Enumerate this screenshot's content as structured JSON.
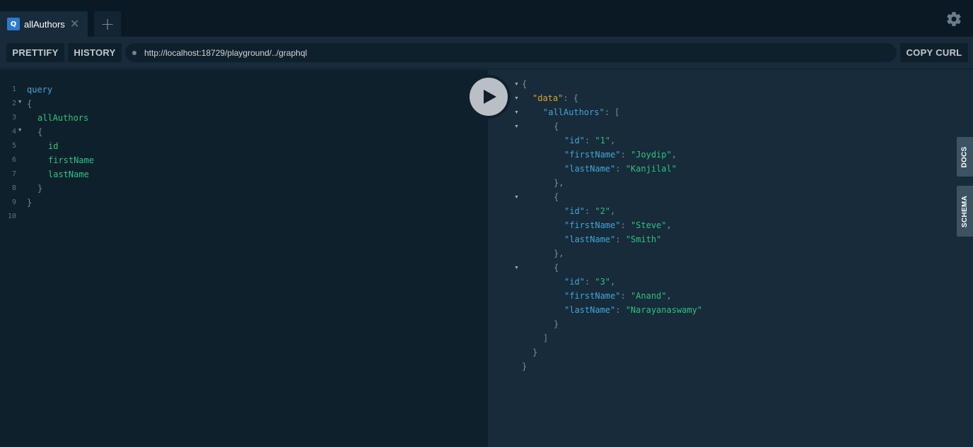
{
  "tabs": [
    {
      "icon": "Q",
      "label": "allAuthors",
      "close": "✕"
    }
  ],
  "add_tab": "+",
  "toolbar": {
    "prettify": "PRETTIFY",
    "history": "HISTORY",
    "url": "http://localhost:18729/playground/../graphql",
    "copy_curl": "COPY CURL"
  },
  "editor": {
    "line_numbers": [
      "1",
      "2",
      "3",
      "4",
      "5",
      "6",
      "7",
      "8",
      "9",
      "10"
    ],
    "lines": [
      {
        "text": "query"
      },
      {
        "text": "{"
      },
      {
        "text": "allAuthors"
      },
      {
        "text": "{"
      },
      {
        "text": "id"
      },
      {
        "text": "firstName"
      },
      {
        "text": "lastName"
      },
      {
        "text": "}"
      },
      {
        "text": "}"
      },
      {
        "text": ""
      }
    ]
  },
  "result": {
    "data_key": "\"data\"",
    "list_key": "\"allAuthors\"",
    "authors": [
      {
        "id": "\"1\"",
        "firstName": "\"Joydip\"",
        "lastName": "\"Kanjilal\""
      },
      {
        "id": "\"2\"",
        "firstName": "\"Steve\"",
        "lastName": "\"Smith\""
      },
      {
        "id": "\"3\"",
        "firstName": "\"Anand\"",
        "lastName": "\"Narayanaswamy\""
      }
    ],
    "field_keys": {
      "id": "\"id\"",
      "firstName": "\"firstName\"",
      "lastName": "\"lastName\""
    }
  },
  "side_tabs": {
    "docs": "DOCS",
    "schema": "SCHEMA"
  },
  "colors": {
    "background": "#172b3a",
    "editor_bg": "#0f202d",
    "keyword": "#42a4d8",
    "field": "#2ec27e",
    "data_key": "#e0a12d",
    "tab_icon": "#2e7bcf"
  }
}
